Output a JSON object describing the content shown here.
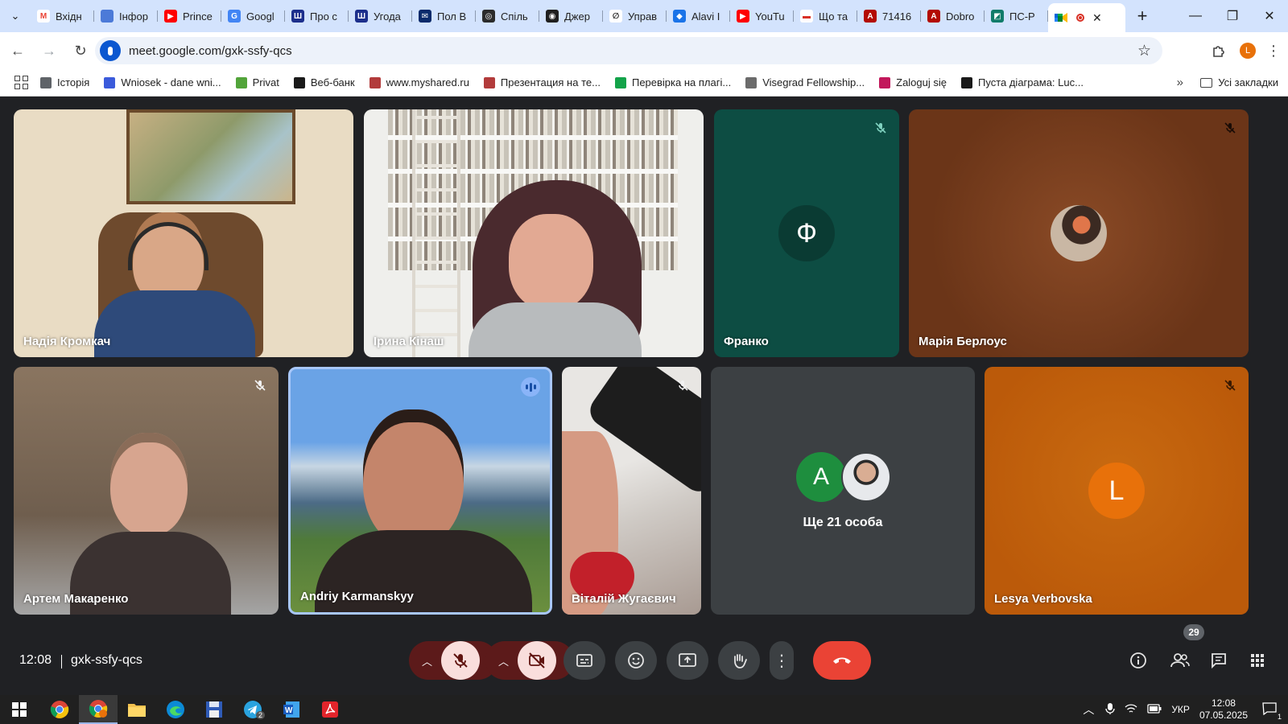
{
  "browser": {
    "tabs": [
      {
        "label": "Вхідн",
        "fav_color": "#ffffff",
        "fav_text": "M",
        "fav_fg": "#ea4335"
      },
      {
        "label": "Інфор",
        "fav_color": "#4c7ad8",
        "fav_text": "",
        "fav_fg": "#fff"
      },
      {
        "label": "Prince",
        "fav_color": "#ff0000",
        "fav_text": "▶",
        "fav_fg": "#fff"
      },
      {
        "label": "Googl",
        "fav_color": "#4285f4",
        "fav_text": "G",
        "fav_fg": "#fff"
      },
      {
        "label": "Про с",
        "fav_color": "#1c2f8c",
        "fav_text": "Ш",
        "fav_fg": "#fff"
      },
      {
        "label": "Угода",
        "fav_color": "#1c2f8c",
        "fav_text": "Ш",
        "fav_fg": "#fff"
      },
      {
        "label": "Пол В",
        "fav_color": "#0a2a6b",
        "fav_text": "✉",
        "fav_fg": "#fff"
      },
      {
        "label": "Спіль",
        "fav_color": "#2b2b2b",
        "fav_text": "◎",
        "fav_fg": "#fff"
      },
      {
        "label": "Джер",
        "fav_color": "#1f1f1f",
        "fav_text": "◉",
        "fav_fg": "#fff"
      },
      {
        "label": "Управ",
        "fav_color": "#ffffff",
        "fav_text": "∅",
        "fav_fg": "#1f1f1f"
      },
      {
        "label": "Alavi I",
        "fav_color": "#1a73e8",
        "fav_text": "◆",
        "fav_fg": "#fff"
      },
      {
        "label": "YouTu",
        "fav_color": "#ff0000",
        "fav_text": "▶",
        "fav_fg": "#fff"
      },
      {
        "label": "Що та",
        "fav_color": "#ffffff",
        "fav_text": "▬",
        "fav_fg": "#d93025"
      },
      {
        "label": "71416",
        "fav_color": "#b30b00",
        "fav_text": "A",
        "fav_fg": "#fff"
      },
      {
        "label": "Dobro",
        "fav_color": "#b30b00",
        "fav_text": "A",
        "fav_fg": "#fff"
      },
      {
        "label": "ПС-Р",
        "fav_color": "#107c6a",
        "fav_text": "◩",
        "fav_fg": "#fff"
      }
    ],
    "active_tab_fav": "meet-icon",
    "url": "meet.google.com/gxk-ssfy-qcs",
    "profile_initial": "L",
    "bookmarks": [
      {
        "label": "Історія",
        "color": "#5f6368"
      },
      {
        "label": "Wniosek - dane wni...",
        "color": "#3b5bdb"
      },
      {
        "label": "Privat",
        "color": "#52a43a"
      },
      {
        "label": "Веб-банк",
        "color": "#1a1a1a"
      },
      {
        "label": "www.myshared.ru",
        "color": "#b23b3b"
      },
      {
        "label": "Презентация на те...",
        "color": "#b23b3b"
      },
      {
        "label": "Перевірка на плагі...",
        "color": "#13a34a"
      },
      {
        "label": "Visegrad Fellowship...",
        "color": "#6b6b6b"
      },
      {
        "label": "Zaloguj się",
        "color": "#c2185b"
      },
      {
        "label": "Пуста діаграма: Luc...",
        "color": "#1a1a1a"
      }
    ],
    "all_bookmarks": "Усі закладки"
  },
  "meet": {
    "participants": [
      {
        "name": "Надія Кромкач"
      },
      {
        "name": "Ірина Кінаш"
      },
      {
        "name": "Франко",
        "initial": "Ф"
      },
      {
        "name": "Марія Берлоус"
      },
      {
        "name": "Артем Макаренко"
      },
      {
        "name": "Andriy Karmanskyy"
      },
      {
        "name": "Віталій Жугаєвич"
      },
      {
        "name": "Lesya Verbovska",
        "initial": "L"
      }
    ],
    "others": {
      "initial": "A",
      "label": "Ще 21 особа"
    },
    "time": "12:08",
    "meeting_code": "gxk-ssfy-qcs",
    "people_count": "29",
    "colors": {
      "franko": "#0d4d43",
      "maria": "#6b3518",
      "lesya": "#bb5a0a",
      "lesya_avatar": "#e8710a",
      "others_avatar": "#1e8e3e",
      "end_call": "#ea4335"
    }
  },
  "taskbar": {
    "lang": "УКР",
    "time": "12:08",
    "date": "07.05.2025",
    "notifications": "1",
    "telegram_badge": "2"
  }
}
